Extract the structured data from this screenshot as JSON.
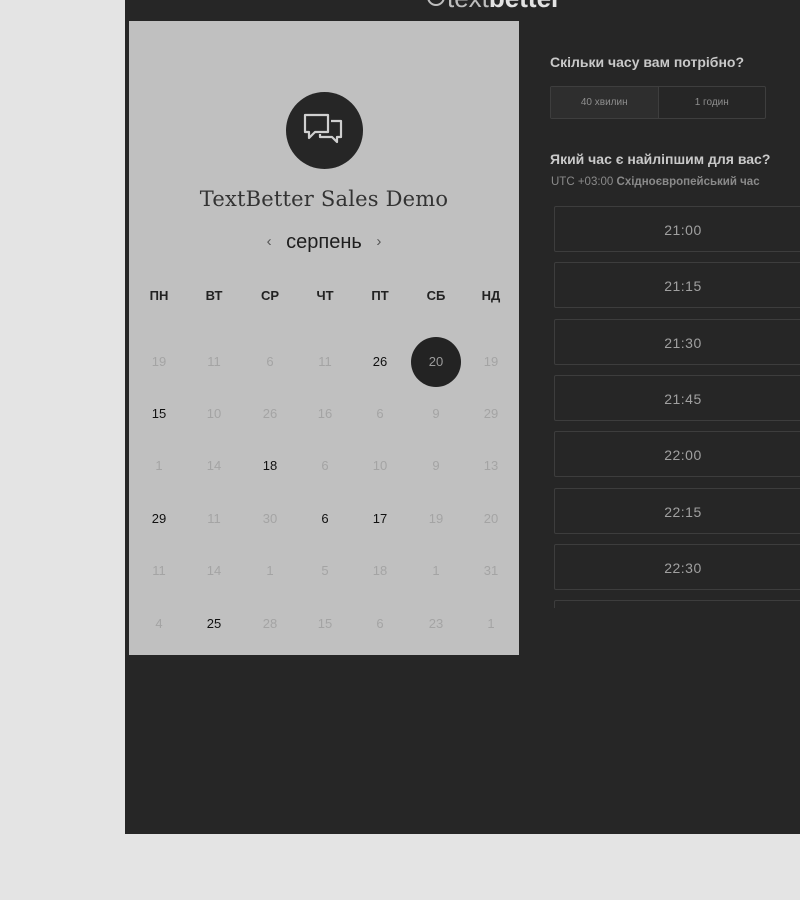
{
  "brand": {
    "logo_light": "text",
    "logo_bold": "better"
  },
  "event": {
    "title": "TextBetter Sales Demo",
    "icon": "chat-bubbles-icon"
  },
  "calendar": {
    "month": "серпень",
    "prev": "‹",
    "next": "›",
    "weekdays": [
      "ПН",
      "ВТ",
      "СР",
      "ЧТ",
      "ПТ",
      "СБ",
      "НД"
    ],
    "weeks": [
      [
        {
          "d": "19",
          "s": "muted"
        },
        {
          "d": "11",
          "s": "muted"
        },
        {
          "d": "6",
          "s": "muted"
        },
        {
          "d": "11",
          "s": "muted"
        },
        {
          "d": "26",
          "s": "active"
        },
        {
          "d": "20",
          "s": "selected"
        },
        {
          "d": "19",
          "s": "muted"
        }
      ],
      [
        {
          "d": "15",
          "s": "active"
        },
        {
          "d": "10",
          "s": "muted"
        },
        {
          "d": "26",
          "s": "muted"
        },
        {
          "d": "16",
          "s": "muted"
        },
        {
          "d": "6",
          "s": "muted"
        },
        {
          "d": "9",
          "s": "muted"
        },
        {
          "d": "29",
          "s": "muted"
        }
      ],
      [
        {
          "d": "1",
          "s": "muted"
        },
        {
          "d": "14",
          "s": "muted"
        },
        {
          "d": "18",
          "s": "active"
        },
        {
          "d": "6",
          "s": "muted"
        },
        {
          "d": "10",
          "s": "muted"
        },
        {
          "d": "9",
          "s": "muted"
        },
        {
          "d": "13",
          "s": "muted"
        }
      ],
      [
        {
          "d": "29",
          "s": "active"
        },
        {
          "d": "11",
          "s": "muted"
        },
        {
          "d": "30",
          "s": "muted"
        },
        {
          "d": "6",
          "s": "active"
        },
        {
          "d": "17",
          "s": "active"
        },
        {
          "d": "19",
          "s": "muted"
        },
        {
          "d": "20",
          "s": "muted"
        }
      ],
      [
        {
          "d": "11",
          "s": "muted"
        },
        {
          "d": "14",
          "s": "muted"
        },
        {
          "d": "1",
          "s": "muted"
        },
        {
          "d": "5",
          "s": "muted"
        },
        {
          "d": "18",
          "s": "muted"
        },
        {
          "d": "1",
          "s": "muted"
        },
        {
          "d": "31",
          "s": "muted"
        }
      ],
      [
        {
          "d": "4",
          "s": "muted"
        },
        {
          "d": "25",
          "s": "active"
        },
        {
          "d": "28",
          "s": "muted"
        },
        {
          "d": "15",
          "s": "muted"
        },
        {
          "d": "6",
          "s": "muted"
        },
        {
          "d": "23",
          "s": "muted"
        },
        {
          "d": "1",
          "s": "muted"
        }
      ]
    ]
  },
  "booking": {
    "duration_question": "Скільки часу вам потрібно?",
    "durations": [
      {
        "label": "40 хвилин",
        "selected": true
      },
      {
        "label": "1 годин",
        "selected": false
      }
    ],
    "time_question": "Який час є найліпшим для вас?",
    "tz_offset": "UTC +03:00",
    "tz_name": "Східноєвропейський час",
    "slots": [
      "21:00",
      "21:15",
      "21:30",
      "21:45",
      "22:00",
      "22:15",
      "22:30",
      ""
    ]
  },
  "colors": {
    "panel_left": "#c0c0c0",
    "panel_dark": "#262626",
    "page_bg": "#e4e4e4"
  }
}
